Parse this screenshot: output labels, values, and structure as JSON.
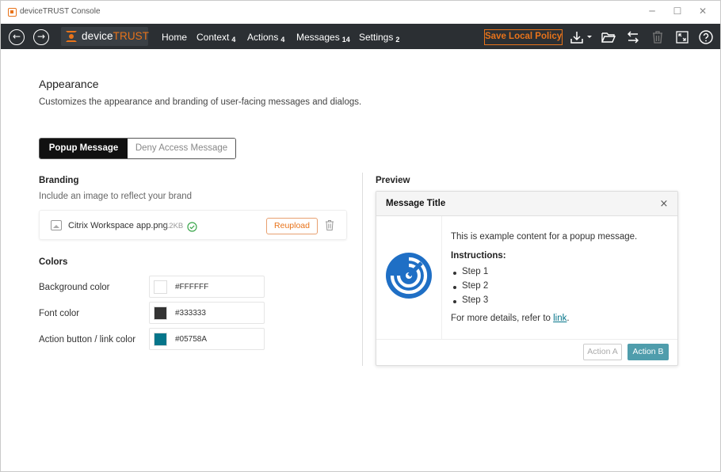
{
  "window": {
    "title": "deviceTRUST Console"
  },
  "toolbar": {
    "brand_prefix": "device",
    "brand_suffix": "TRUST",
    "menu": [
      {
        "label": "Home",
        "count": ""
      },
      {
        "label": "Context",
        "count": "4"
      },
      {
        "label": "Actions",
        "count": "4"
      },
      {
        "label": "Messages",
        "count": "14"
      },
      {
        "label": "Settings",
        "count": "2"
      }
    ],
    "save_label": "Save Local Policy"
  },
  "page": {
    "title": "Appearance",
    "description": "Customizes the appearance and branding of user-facing messages and dialogs."
  },
  "tabs": [
    {
      "label": "Popup Message",
      "active": true
    },
    {
      "label": "Deny Access Message",
      "active": false
    }
  ],
  "branding": {
    "heading": "Branding",
    "subtitle": "Include an image to reflect your brand",
    "file_name": "Citrix Workspace app.png",
    "file_size": "12KB",
    "reupload_label": "Reupload"
  },
  "colors": {
    "heading": "Colors",
    "items": [
      {
        "label": "Background color",
        "value": "#FFFFFF"
      },
      {
        "label": "Font color",
        "value": "#333333"
      },
      {
        "label": "Action button / link color",
        "value": "#05758A"
      }
    ]
  },
  "preview": {
    "heading": "Preview",
    "dialog_title": "Message Title",
    "close_glyph": "×",
    "content": "This is example content for a popup message.",
    "instructions_label": "Instructions:",
    "steps": [
      "Step 1",
      "Step 2",
      "Step 3"
    ],
    "details_prefix": "For more details, refer to ",
    "details_link": "link",
    "details_suffix": ".",
    "action_a": "Action A",
    "action_b": "Action B"
  },
  "icons": {
    "back": "arrow-left-circle-icon",
    "forward": "arrow-right-circle-icon",
    "download": "download-icon",
    "folder": "folder-open-icon",
    "swap": "swap-icon",
    "trash": "trash-icon",
    "expand": "expand-icon",
    "help": "help-circle-icon"
  },
  "accent_color": "#E8731A",
  "link_color": "#05758A"
}
